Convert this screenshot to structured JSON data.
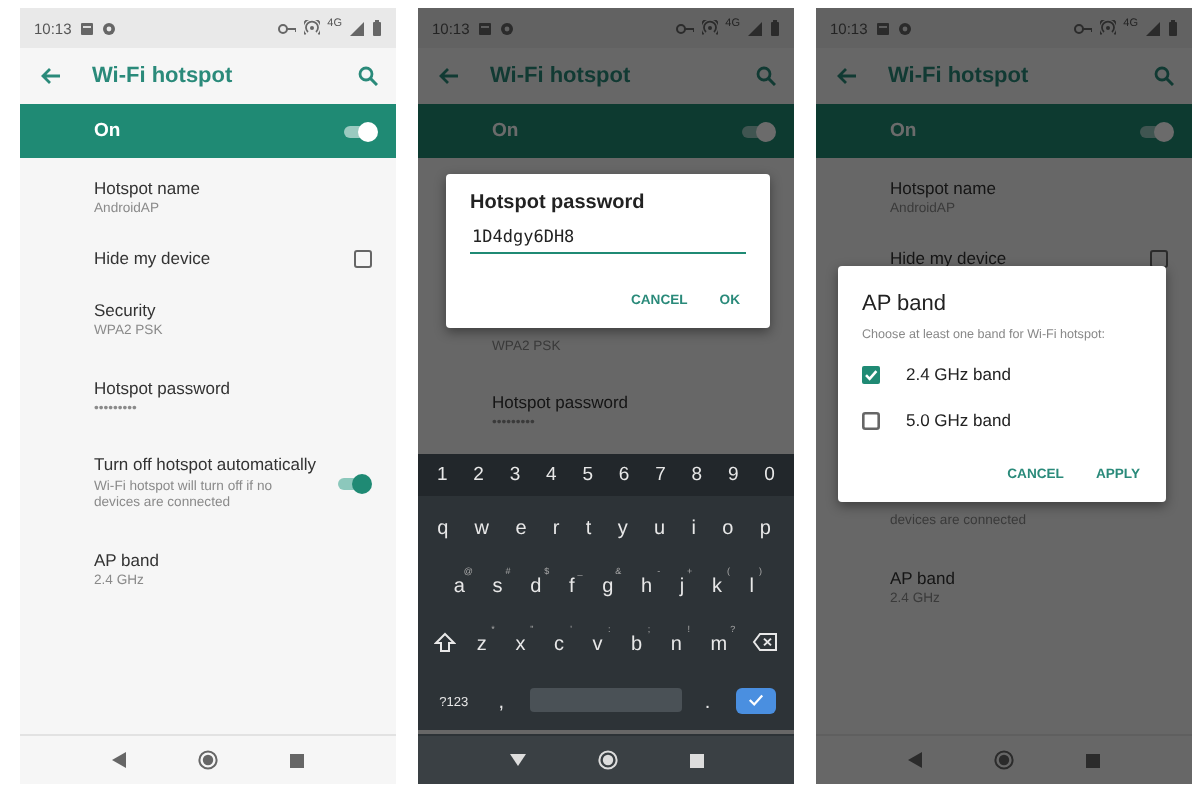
{
  "screens": [
    {
      "status": {
        "time": "10:13",
        "network": "4G"
      },
      "app_bar": {
        "title": "Wi-Fi hotspot"
      },
      "master_switch": {
        "label": "On",
        "on": true
      },
      "dimmed": false,
      "rows_above": [
        {
          "kind": "text",
          "title": "Hotspot name",
          "subtitle": "AndroidAP"
        },
        {
          "kind": "checkbox",
          "title": "Hide my device",
          "checked": false
        },
        {
          "kind": "text",
          "title": "Security",
          "subtitle": "WPA2 PSK"
        },
        {
          "kind": "text",
          "title": "Hotspot password",
          "subtitle": "•••••••••"
        },
        {
          "kind": "switch",
          "title": "Turn off hotspot automatically",
          "subtitle": "Wi-Fi hotspot will turn off if no devices are connected",
          "on": true
        },
        {
          "kind": "text",
          "title": "AP band",
          "subtitle": "2.4 GHz"
        }
      ]
    },
    {
      "status": {
        "time": "10:13",
        "network": "4G"
      },
      "app_bar": {
        "title": "Wi-Fi hotspot"
      },
      "master_switch": {
        "label": "On",
        "on": true
      },
      "dimmed": true,
      "dialog": {
        "kind": "input",
        "title": "Hotspot password",
        "value": "1D4dgy6DH8",
        "buttons": [
          "CANCEL",
          "OK"
        ]
      },
      "rows_below": [
        {
          "kind": "text",
          "subtitle": "WPA2 PSK"
        },
        {
          "kind": "text",
          "title": "Hotspot password",
          "subtitle": "•••••••••"
        }
      ],
      "keyboard": {
        "number_row": [
          "1",
          "2",
          "3",
          "4",
          "5",
          "6",
          "7",
          "8",
          "9",
          "0"
        ],
        "rows": [
          {
            "keys": [
              {
                "key": "q"
              },
              {
                "key": "w"
              },
              {
                "key": "e"
              },
              {
                "key": "r"
              },
              {
                "key": "t"
              },
              {
                "key": "y"
              },
              {
                "key": "u"
              },
              {
                "key": "i"
              },
              {
                "key": "o"
              },
              {
                "key": "p"
              }
            ]
          },
          {
            "keys": [
              {
                "key": "a",
                "hint": "@"
              },
              {
                "key": "s",
                "hint": "#"
              },
              {
                "key": "d",
                "hint": "$"
              },
              {
                "key": "f",
                "hint": "_"
              },
              {
                "key": "g",
                "hint": "&"
              },
              {
                "key": "h",
                "hint": "-"
              },
              {
                "key": "j",
                "hint": "+"
              },
              {
                "key": "k",
                "hint": "("
              },
              {
                "key": "l",
                "hint": ")"
              }
            ]
          },
          {
            "keys": [
              {
                "key": "z",
                "hint": "*"
              },
              {
                "key": "x",
                "hint": "\""
              },
              {
                "key": "c",
                "hint": "'"
              },
              {
                "key": "v",
                "hint": ":"
              },
              {
                "key": "b",
                "hint": ";"
              },
              {
                "key": "n",
                "hint": "!"
              },
              {
                "key": "m",
                "hint": "?"
              }
            ]
          }
        ],
        "symbols_key": "?123",
        "comma_key": ",",
        "period_key": "."
      }
    },
    {
      "status": {
        "time": "10:13",
        "network": "4G"
      },
      "app_bar": {
        "title": "Wi-Fi hotspot"
      },
      "master_switch": {
        "label": "On",
        "on": true
      },
      "dimmed": true,
      "rows_above": [
        {
          "kind": "text",
          "title": "Hotspot name",
          "subtitle": "AndroidAP"
        },
        {
          "kind": "checkbox",
          "title": "Hide my device",
          "checked": false
        }
      ],
      "dialog": {
        "kind": "choice",
        "title": "AP band",
        "message": "Choose at least one band for Wi-Fi hotspot:",
        "options": [
          {
            "label": "2.4 GHz band",
            "checked": true
          },
          {
            "label": "5.0 GHz band",
            "checked": false
          }
        ],
        "buttons": [
          "CANCEL",
          "APPLY"
        ]
      },
      "rows_below": [
        {
          "kind": "text",
          "subtitle": "devices are connected"
        },
        {
          "kind": "text",
          "title": "AP band",
          "subtitle": "2.4 GHz"
        }
      ]
    }
  ]
}
